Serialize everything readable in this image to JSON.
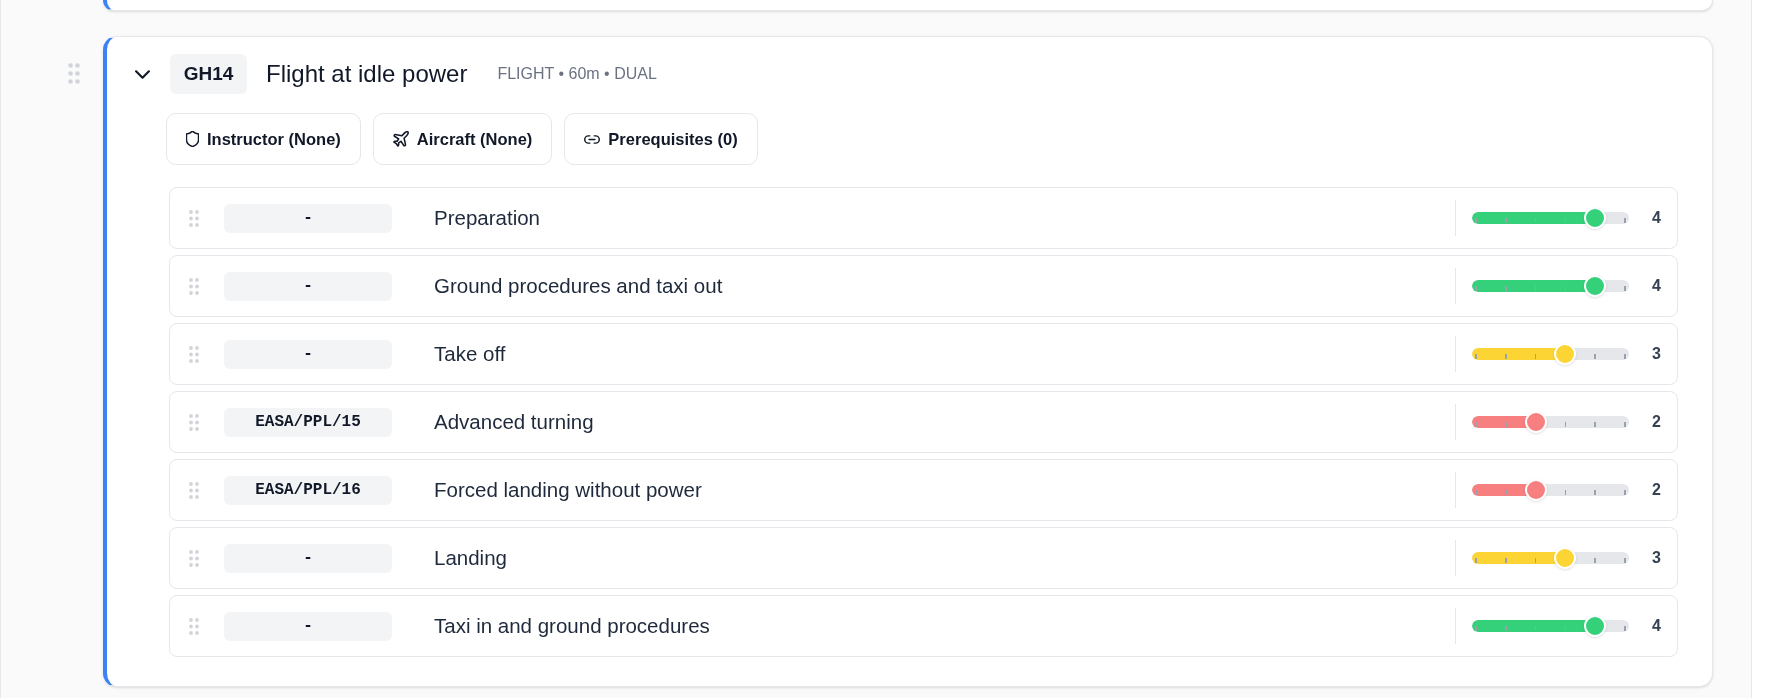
{
  "lesson": {
    "code": "GH14",
    "title": "Flight at idle power",
    "meta": "FLIGHT • 60m • DUAL",
    "expanded": true,
    "buttons": [
      {
        "kind": "instructor",
        "label": "Instructor (None)"
      },
      {
        "kind": "aircraft",
        "label": "Aircraft (None)"
      },
      {
        "kind": "prerequisites",
        "label": "Prerequisites (0)"
      }
    ],
    "items": [
      {
        "reference": "-",
        "name": "Preparation",
        "level": 0.8,
        "color": "#34d17a",
        "rating": "4"
      },
      {
        "reference": "-",
        "name": "Ground procedures and taxi out",
        "level": 0.8,
        "color": "#34d17a",
        "rating": "4"
      },
      {
        "reference": "-",
        "name": "Take off",
        "level": 0.6,
        "color": "#fcd535",
        "rating": "3"
      },
      {
        "reference": "EASA/PPL/15",
        "name": "Advanced turning",
        "level": 0.4,
        "color": "#f87f7f",
        "rating": "2"
      },
      {
        "reference": "EASA/PPL/16",
        "name": "Forced landing without power",
        "level": 0.4,
        "color": "#f87f7f",
        "rating": "2"
      },
      {
        "reference": "-",
        "name": "Landing",
        "level": 0.6,
        "color": "#fcd535",
        "rating": "3"
      },
      {
        "reference": "-",
        "name": "Taxi in and ground procedures",
        "level": 0.8,
        "color": "#34d17a",
        "rating": "4"
      }
    ]
  }
}
